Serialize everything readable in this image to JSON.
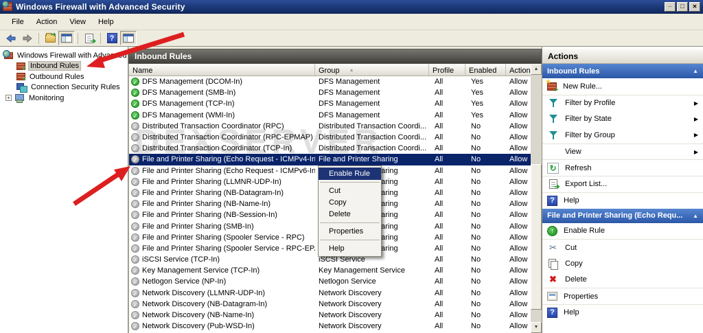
{
  "window": {
    "title": "Windows Firewall with Advanced Security"
  },
  "menu": {
    "items": [
      "File",
      "Action",
      "View",
      "Help"
    ]
  },
  "tree": {
    "root": "Windows Firewall with Advanced S",
    "items": [
      {
        "label": "Inbound Rules",
        "selected": true
      },
      {
        "label": "Outbound Rules",
        "selected": false
      },
      {
        "label": "Connection Security Rules",
        "selected": false
      },
      {
        "label": "Monitoring",
        "selected": false,
        "expandable": true
      }
    ]
  },
  "list": {
    "title": "Inbound Rules",
    "columns": [
      "Name",
      "Group",
      "Profile",
      "Enabled",
      "Action"
    ],
    "sort_column": "Group",
    "watermark": "DEXSERVER",
    "rows": [
      {
        "name": "DFS Management (DCOM-In)",
        "group": "DFS Management",
        "profile": "All",
        "enabled": "Yes",
        "action": "Allow",
        "on": true,
        "selected": false
      },
      {
        "name": "DFS Management (SMB-In)",
        "group": "DFS Management",
        "profile": "All",
        "enabled": "Yes",
        "action": "Allow",
        "on": true,
        "selected": false
      },
      {
        "name": "DFS Management (TCP-In)",
        "group": "DFS Management",
        "profile": "All",
        "enabled": "Yes",
        "action": "Allow",
        "on": true,
        "selected": false
      },
      {
        "name": "DFS Management (WMI-In)",
        "group": "DFS Management",
        "profile": "All",
        "enabled": "Yes",
        "action": "Allow",
        "on": true,
        "selected": false
      },
      {
        "name": "Distributed Transaction Coordinator (RPC)",
        "group": "Distributed Transaction Coordi...",
        "profile": "All",
        "enabled": "No",
        "action": "Allow",
        "on": false,
        "selected": false
      },
      {
        "name": "Distributed Transaction Coordinator (RPC-EPMAP)",
        "group": "Distributed Transaction Coordi...",
        "profile": "All",
        "enabled": "No",
        "action": "Allow",
        "on": false,
        "selected": false
      },
      {
        "name": "Distributed Transaction Coordinator (TCP-In)",
        "group": "Distributed Transaction Coordi...",
        "profile": "All",
        "enabled": "No",
        "action": "Allow",
        "on": false,
        "selected": false
      },
      {
        "name": "File and Printer Sharing (Echo Request - ICMPv4-In)",
        "group": "File and Printer Sharing",
        "profile": "All",
        "enabled": "No",
        "action": "Allow",
        "on": false,
        "selected": true
      },
      {
        "name": "File and Printer Sharing (Echo Request - ICMPv6-In)",
        "group": "File and Printer Sharing",
        "profile": "All",
        "enabled": "No",
        "action": "Allow",
        "on": false,
        "selected": false
      },
      {
        "name": "File and Printer Sharing (LLMNR-UDP-In)",
        "group": "File and Printer Sharing",
        "profile": "All",
        "enabled": "No",
        "action": "Allow",
        "on": false,
        "selected": false
      },
      {
        "name": "File and Printer Sharing (NB-Datagram-In)",
        "group": "File and Printer Sharing",
        "profile": "All",
        "enabled": "No",
        "action": "Allow",
        "on": false,
        "selected": false
      },
      {
        "name": "File and Printer Sharing (NB-Name-In)",
        "group": "File and Printer Sharing",
        "profile": "All",
        "enabled": "No",
        "action": "Allow",
        "on": false,
        "selected": false
      },
      {
        "name": "File and Printer Sharing (NB-Session-In)",
        "group": "File and Printer Sharing",
        "profile": "All",
        "enabled": "No",
        "action": "Allow",
        "on": false,
        "selected": false
      },
      {
        "name": "File and Printer Sharing (SMB-In)",
        "group": "File and Printer Sharing",
        "profile": "All",
        "enabled": "No",
        "action": "Allow",
        "on": false,
        "selected": false
      },
      {
        "name": "File and Printer Sharing (Spooler Service - RPC)",
        "group": "File and Printer Sharing",
        "profile": "All",
        "enabled": "No",
        "action": "Allow",
        "on": false,
        "selected": false
      },
      {
        "name": "File and Printer Sharing (Spooler Service - RPC-EP...",
        "group": "File and Printer Sharing",
        "profile": "All",
        "enabled": "No",
        "action": "Allow",
        "on": false,
        "selected": false
      },
      {
        "name": "iSCSI Service (TCP-In)",
        "group": "iSCSI Service",
        "profile": "All",
        "enabled": "No",
        "action": "Allow",
        "on": false,
        "selected": false
      },
      {
        "name": "Key Management Service (TCP-In)",
        "group": "Key Management Service",
        "profile": "All",
        "enabled": "No",
        "action": "Allow",
        "on": false,
        "selected": false
      },
      {
        "name": "Netlogon Service (NP-In)",
        "group": "Netlogon Service",
        "profile": "All",
        "enabled": "No",
        "action": "Allow",
        "on": false,
        "selected": false
      },
      {
        "name": "Network Discovery (LLMNR-UDP-In)",
        "group": "Network Discovery",
        "profile": "All",
        "enabled": "No",
        "action": "Allow",
        "on": false,
        "selected": false
      },
      {
        "name": "Network Discovery (NB-Datagram-In)",
        "group": "Network Discovery",
        "profile": "All",
        "enabled": "No",
        "action": "Allow",
        "on": false,
        "selected": false
      },
      {
        "name": "Network Discovery (NB-Name-In)",
        "group": "Network Discovery",
        "profile": "All",
        "enabled": "No",
        "action": "Allow",
        "on": false,
        "selected": false
      },
      {
        "name": "Network Discovery (Pub-WSD-In)",
        "group": "Network Discovery",
        "profile": "All",
        "enabled": "No",
        "action": "Allow",
        "on": false,
        "selected": false
      }
    ]
  },
  "context_menu": {
    "enable_rule": "Enable Rule",
    "cut": "Cut",
    "copy": "Copy",
    "delete": "Delete",
    "properties": "Properties",
    "help": "Help"
  },
  "actions_pane": {
    "title": "Actions",
    "section1": {
      "title": "Inbound Rules",
      "new_rule": "New Rule...",
      "filter_profile": "Filter by Profile",
      "filter_state": "Filter by State",
      "filter_group": "Filter by Group",
      "view": "View",
      "refresh": "Refresh",
      "export_list": "Export List...",
      "help": "Help"
    },
    "section2": {
      "title": "File and Printer Sharing (Echo Requ...",
      "enable_rule": "Enable Rule",
      "cut": "Cut",
      "copy": "Copy",
      "delete": "Delete",
      "properties": "Properties",
      "help": "Help"
    }
  },
  "colors": {
    "titlebar": "#1b3876",
    "selection": "#0a246a",
    "section_header_blue": "#2b57a7",
    "annotation_arrow_red": "#dd1f1f",
    "enabled_icon_green": "#1d9b1d",
    "disabled_icon_gray": "#9e9e9e"
  }
}
